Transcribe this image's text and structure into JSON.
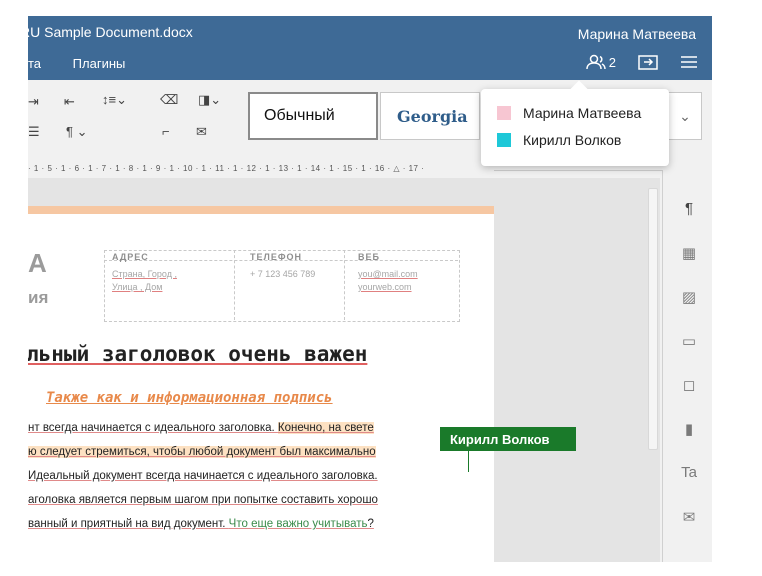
{
  "window": {
    "title": "RU Sample Document.docx",
    "user": "Марина Матвеева"
  },
  "menu": [
    "Вставка",
    "Плагины"
  ],
  "menu_visible": [
    "та",
    "Плагины"
  ],
  "header_icons": {
    "users_count": "2",
    "users_icon": "users-icon",
    "open_location_icon": "open-location-icon",
    "menu_icon": "hamburger-menu-icon"
  },
  "toolbar": {
    "style_normal": "Обычный",
    "style_georgia": "Georgia",
    "paragraph_mark": "¶"
  },
  "ruler": "· 1 · 5 · 1 · 6 · 1 · 7 · 1 · 8 · 1 · 9 · 1 · 10 · 1 · 11 · 1 · 12 · 1 · 13 · 1 · 14 · 1 · 15 · 1 · 16 · △ · 17 ·",
  "document": {
    "big_letter": "А",
    "big_sub": "ия",
    "contacts": [
      {
        "label": "АДРЕС",
        "lines": [
          "Страна,  Город ,",
          "Улица , Дом"
        ]
      },
      {
        "label": "ТЕЛЕФОН",
        "lines": [
          "+ 7 123 456 789"
        ]
      },
      {
        "label": "ВЕБ",
        "lines": [
          "you@mail.com",
          "yourweb.com"
        ]
      }
    ],
    "heading": "льный заголовок очень важен",
    "subheading": "Также как и информационная подпись",
    "paragraphs": [
      {
        "text": "нт всегда начинается с идеального заголовка. ",
        "highlight": "Конечно, на свете"
      },
      {
        "text": "",
        "highlight": "ю следует стремиться, чтобы любой документ был максимально"
      },
      {
        "text": "Идеальный документ всегда начинается с идеального заголовка.",
        "highlight": ""
      },
      {
        "text": "аголовка является первым шагом при попытке составить хорошо",
        "highlight": ""
      },
      {
        "text": "ванный и приятный на вид документ. ",
        "green": "Что еще важно учитывать",
        "tail": "?"
      }
    ]
  },
  "collaborator_cursor": {
    "name": "Кирилл Волков",
    "color": "#1a7a2a"
  },
  "users_popup": [
    {
      "name": "Марина Матвеева",
      "color": "#f7c6d2"
    },
    {
      "name": "Кирилл Волков",
      "color": "#1ec8d8"
    }
  ]
}
